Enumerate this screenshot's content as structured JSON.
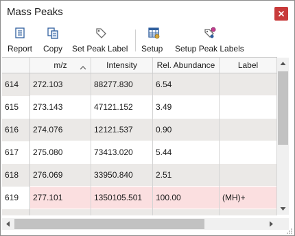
{
  "window": {
    "title": "Mass Peaks",
    "close_label": "×"
  },
  "toolbar": {
    "buttons": [
      {
        "label": "Report",
        "icon": "report-icon"
      },
      {
        "label": "Copy",
        "icon": "copy-icon"
      },
      {
        "label": "Set Peak Label",
        "icon": "tag-icon"
      },
      {
        "label": "Setup",
        "icon": "table-setup-icon"
      },
      {
        "label": "Setup Peak Labels",
        "icon": "tag-setup-icon"
      }
    ]
  },
  "table": {
    "columns": [
      "",
      "m/z",
      "Intensity",
      "Rel. Abundance",
      "Label"
    ],
    "sorted_column": "m/z",
    "sort_direction": "ascending",
    "rows": [
      {
        "index": "614",
        "mz": "272.103",
        "intensity": "88277.830",
        "abundance": "6.54",
        "label": "",
        "style": "gray"
      },
      {
        "index": "615",
        "mz": "273.143",
        "intensity": "47121.152",
        "abundance": "3.49",
        "label": "",
        "style": "white"
      },
      {
        "index": "616",
        "mz": "274.076",
        "intensity": "12121.537",
        "abundance": "0.90",
        "label": "",
        "style": "gray"
      },
      {
        "index": "617",
        "mz": "275.080",
        "intensity": "73413.020",
        "abundance": "5.44",
        "label": "",
        "style": "white"
      },
      {
        "index": "618",
        "mz": "276.069",
        "intensity": "33950.840",
        "abundance": "2.51",
        "label": "",
        "style": "gray"
      },
      {
        "index": "619",
        "mz": "277.101",
        "intensity": "1350105.501",
        "abundance": "100.00",
        "label": "(MH)+",
        "style": "pink"
      }
    ]
  },
  "colors": {
    "close_button": "#c83a3a",
    "row_gray": "#ebe9e7",
    "row_highlight": "#fbdfe0",
    "icon_blue": "#2f5f9e"
  }
}
